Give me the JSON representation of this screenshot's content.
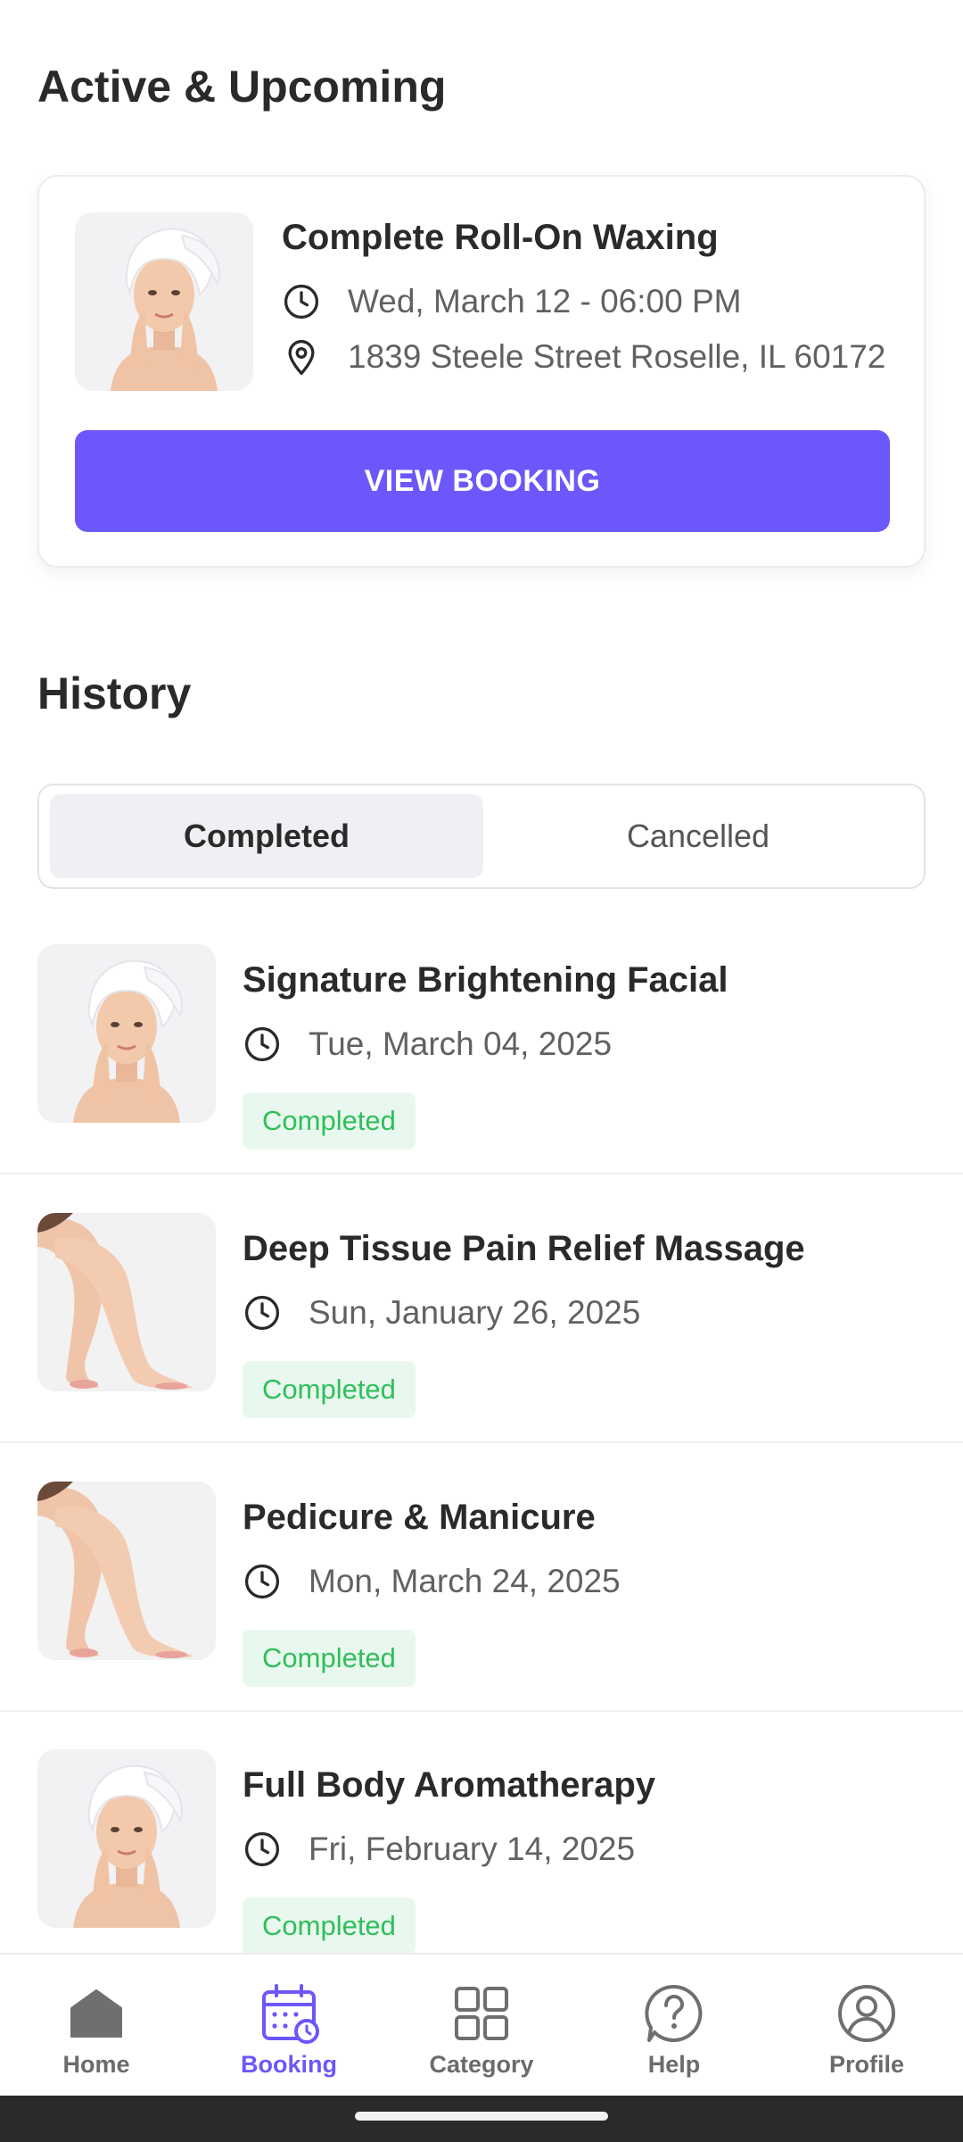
{
  "upcoming": {
    "section_title": "Active & Upcoming",
    "service": "Complete Roll-On Waxing",
    "datetime": "Wed, March 12 - 06:00 PM",
    "address": "1839 Steele Street Roselle, IL 60172",
    "button_label": "VIEW BOOKING",
    "image": "woman-towel-portrait"
  },
  "history": {
    "section_title": "History",
    "tabs": [
      {
        "label": "Completed",
        "selected": true
      },
      {
        "label": "Cancelled",
        "selected": false
      }
    ],
    "items": [
      {
        "title": "Signature Brightening Facial",
        "date": "Tue, March 04, 2025",
        "status": "Completed",
        "image": "woman-towel-portrait"
      },
      {
        "title": "Deep Tissue Pain Relief Massage",
        "date": "Sun, January 26, 2025",
        "status": "Completed",
        "image": "legs-photo"
      },
      {
        "title": "Pedicure & Manicure",
        "date": "Mon, March 24, 2025",
        "status": "Completed",
        "image": "legs-photo"
      },
      {
        "title": "Full Body Aromatherapy",
        "date": "Fri, February 14, 2025",
        "status": "Completed",
        "image": "woman-towel-portrait"
      }
    ]
  },
  "nav": {
    "items": [
      {
        "label": "Home",
        "icon": "home-icon",
        "active": false
      },
      {
        "label": "Booking",
        "icon": "calendar-icon",
        "active": true
      },
      {
        "label": "Category",
        "icon": "grid-icon",
        "active": false
      },
      {
        "label": "Help",
        "icon": "help-icon",
        "active": false
      },
      {
        "label": "Profile",
        "icon": "profile-icon",
        "active": false
      }
    ]
  },
  "colors": {
    "accent": "#6c57fb",
    "status_completed_text": "#2fbf5a",
    "status_completed_bg": "#e9f8ee"
  }
}
